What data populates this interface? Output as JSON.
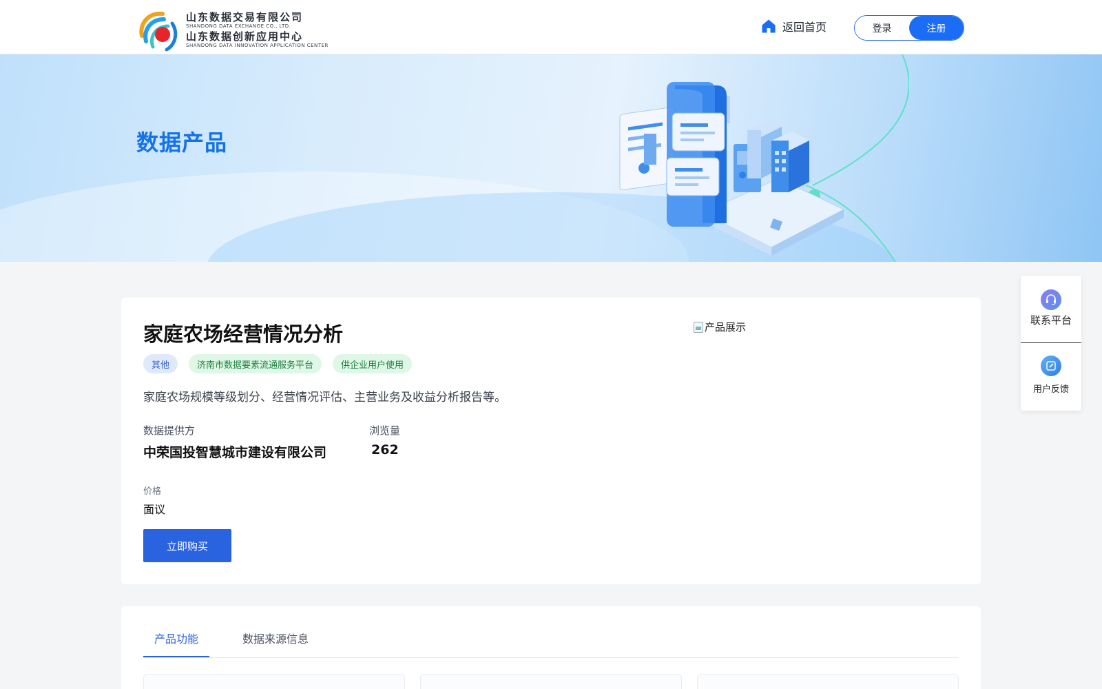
{
  "header": {
    "logo": {
      "line1": "山东数据交易有限公司",
      "line2": "SHANDONG DATA EXCHANGE CO., LTD.",
      "line3": "山东数据创新应用中心",
      "line4": "SHANDONG DATA INNOVATION APPLICATION CENTER"
    },
    "home_label": "返回首页",
    "login_label": "登录",
    "register_label": "注册"
  },
  "banner": {
    "title": "数据产品"
  },
  "product": {
    "title": "家庭农场经营情况分析",
    "tags": [
      "其他",
      "济南市数据要素流通服务平台",
      "供企业用户使用"
    ],
    "description": "家庭农场规模等级划分、经营情况评估、主营业务及收益分析报告等。",
    "provider_label": "数据提供方",
    "provider_value": "中荣国投智慧城市建设有限公司",
    "views_label": "浏览量",
    "views_value": "262",
    "price_label": "价格",
    "price_value": "面议",
    "buy_label": "立即购买",
    "image_alt": "产品展示"
  },
  "float_panel": {
    "contact_label": "联系平台",
    "feedback_label": "用户反馈"
  },
  "tabs": {
    "items": [
      "产品功能",
      "数据来源信息"
    ],
    "active": "产品功能"
  },
  "colors": {
    "primary": "#2a63e0",
    "brand_blue": "#1471e6",
    "register_bg": "#1b6df5"
  }
}
